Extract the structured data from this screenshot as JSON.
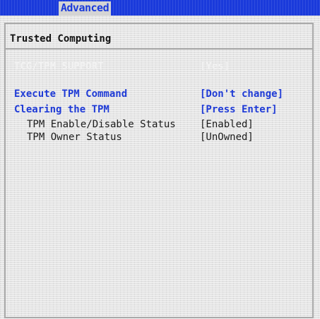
{
  "header": {
    "active_tab": "Advanced"
  },
  "page": {
    "title": "Trusted Computing"
  },
  "settings": [
    {
      "label": "TCG/TPM SUPPORT",
      "value": "[Yes]",
      "state": "disabled"
    },
    {
      "label": "Execute TPM Command",
      "value": "[Don't change]",
      "state": "selectable"
    },
    {
      "label": "Clearing the TPM",
      "value": "[Press Enter]",
      "state": "selectable"
    },
    {
      "label": "TPM Enable/Disable Status",
      "value": "[Enabled]",
      "state": "info"
    },
    {
      "label": "TPM Owner Status",
      "value": "[UnOwned]",
      "state": "info"
    }
  ],
  "colors": {
    "header_blue": "#1a3adb",
    "tab_background": "#d4d4d4",
    "panel_background": "#e5e5e5",
    "selectable_text": "#1f3bd6",
    "disabled_text": "#f2f2f2",
    "info_text": "#1b1b1b"
  }
}
